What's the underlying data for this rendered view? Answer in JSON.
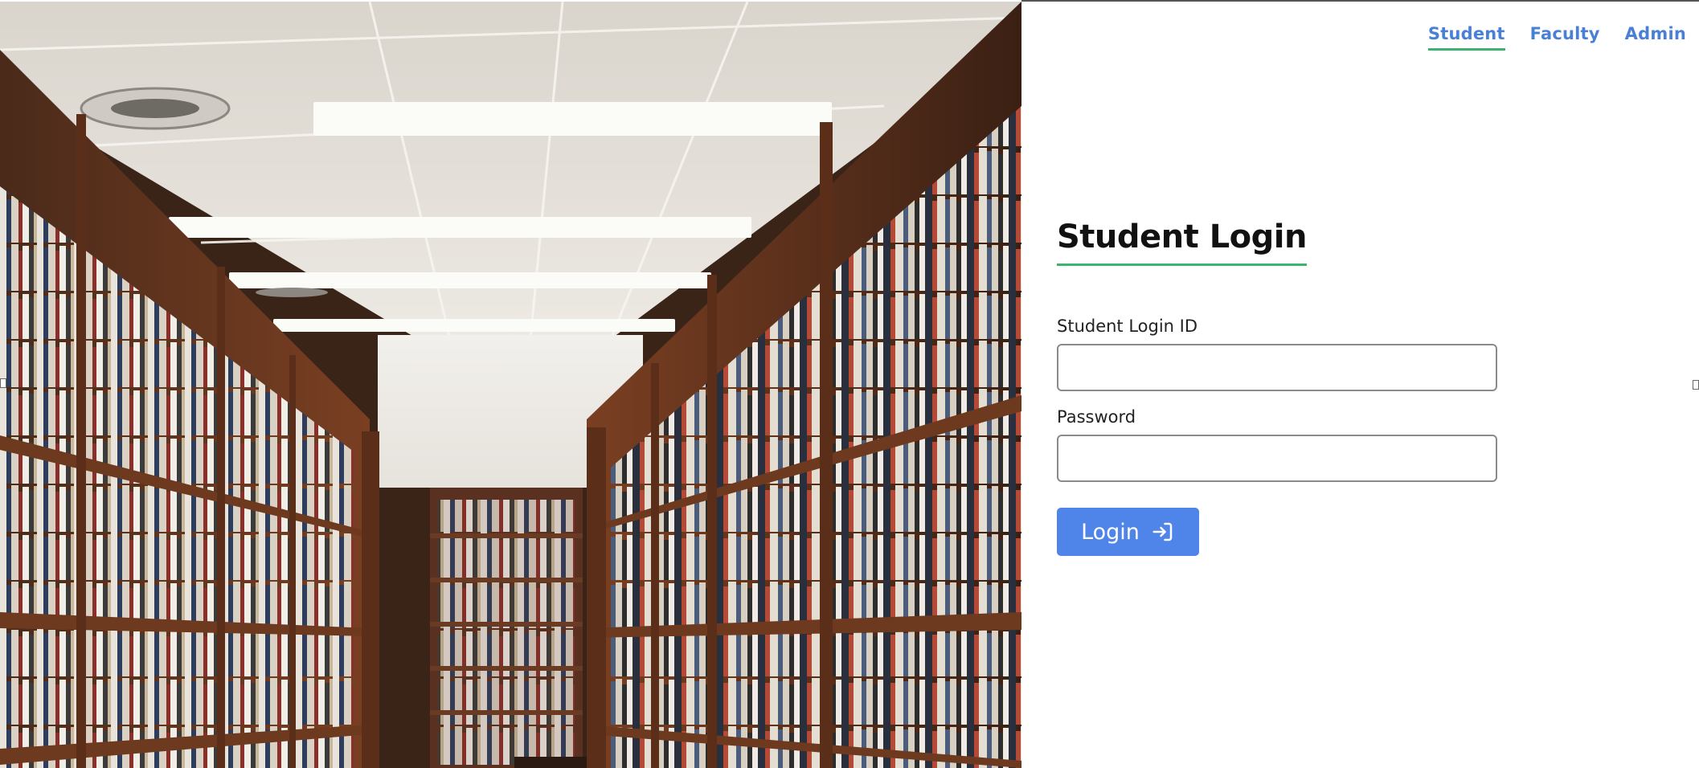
{
  "nav": {
    "items": [
      {
        "label": "Student",
        "active": true
      },
      {
        "label": "Faculty",
        "active": false
      },
      {
        "label": "Admin",
        "active": false
      }
    ]
  },
  "login": {
    "title": "Student Login",
    "id_label": "Student Login ID",
    "id_value": "",
    "password_label": "Password",
    "password_value": "",
    "button_label": "Login",
    "button_icon": "login-arrow-icon"
  },
  "theme": {
    "accent_blue": "#4f84e8",
    "nav_blue": "#4a7fd6",
    "underline_green": "#3cb371"
  },
  "hero": {
    "image": "library-bookshelves-aisle"
  }
}
